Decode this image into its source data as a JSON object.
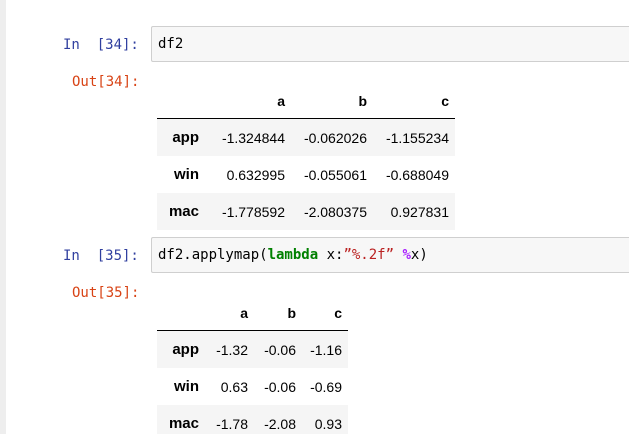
{
  "cells": [
    {
      "in_prompt": "In  [34]:",
      "code": {
        "text": "df2"
      },
      "out_prompt": "Out[34]:",
      "table": {
        "columns": [
          "a",
          "b",
          "c"
        ],
        "rows": [
          {
            "index": "app",
            "values": [
              "-1.324844",
              "-0.062026",
              "-1.155234"
            ]
          },
          {
            "index": "win",
            "values": [
              "0.632995",
              "-0.055061",
              "-0.688049"
            ]
          },
          {
            "index": "mac",
            "values": [
              "-1.778592",
              "-2.080375",
              "0.927831"
            ]
          }
        ]
      }
    },
    {
      "in_prompt": "In  [35]:",
      "code": {
        "pre": "df2.applymap(",
        "keyword": "lambda",
        "mid": " x:",
        "string": "”%.2f”",
        "space": " ",
        "operator": "%",
        "post": "x)"
      },
      "out_prompt": "Out[35]:",
      "table": {
        "columns": [
          "a",
          "b",
          "c"
        ],
        "rows": [
          {
            "index": "app",
            "values": [
              "-1.32",
              "-0.06",
              "-1.16"
            ]
          },
          {
            "index": "win",
            "values": [
              "0.63",
              "-0.06",
              "-0.69"
            ]
          },
          {
            "index": "mac",
            "values": [
              "-1.78",
              "-2.08",
              "0.93"
            ]
          }
        ]
      }
    }
  ]
}
